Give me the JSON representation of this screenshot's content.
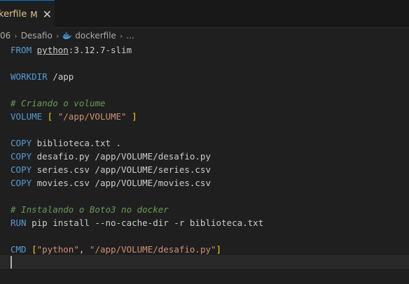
{
  "tab": {
    "label": "kerfile",
    "modified": "M",
    "close": "✕"
  },
  "breadcrumb": {
    "parent": "06",
    "folder": "Desafio",
    "file": "dockerfile",
    "more": "..."
  },
  "code": {
    "from_kw": "FROM",
    "from_image": "python",
    "from_tag": ":3.12.7-slim",
    "workdir_kw": "WORKDIR",
    "workdir_arg": " /app",
    "comment1": "# Criando o volume",
    "volume_kw": "VOLUME",
    "volume_open": " [",
    "volume_str": " \"/app/VOLUME\"",
    "volume_close": " ]",
    "copy_kw": "COPY",
    "copy1_args": " biblioteca.txt .",
    "copy2_args": " desafio.py /app/VOLUME/desafio.py",
    "copy3_args": " series.csv /app/VOLUME/series.csv",
    "copy4_args": " movies.csv /app/VOLUME/movies.csv",
    "comment2": "# Instalando o Boto3 no docker",
    "run_kw": "RUN",
    "run_args": " pip install --no-cache-dir -r biblioteca.txt",
    "cmd_kw": "CMD",
    "cmd_open": " [",
    "cmd_str1": "\"python\"",
    "cmd_comma": ", ",
    "cmd_str2": "\"/app/VOLUME/desafio.py\"",
    "cmd_close": "]"
  },
  "colors": {
    "keyword": "#569cd6",
    "comment": "#6a9955",
    "string": "#ce9178",
    "bracket": "#ffd700",
    "modified": "#e2c08d"
  }
}
